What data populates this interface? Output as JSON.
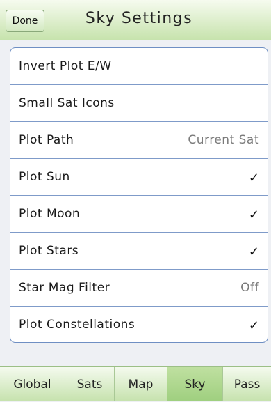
{
  "header": {
    "done_label": "Done",
    "title": "Sky Settings"
  },
  "settings": [
    {
      "label": "Invert Plot E/W",
      "value": "",
      "checked": false
    },
    {
      "label": "Small Sat Icons",
      "value": "",
      "checked": false
    },
    {
      "label": "Plot Path",
      "value": "Current Sat",
      "checked": false
    },
    {
      "label": "Plot Sun",
      "value": "",
      "checked": true
    },
    {
      "label": "Plot Moon",
      "value": "",
      "checked": true
    },
    {
      "label": "Plot Stars",
      "value": "",
      "checked": true
    },
    {
      "label": "Star Mag Filter",
      "value": "Off",
      "checked": false
    },
    {
      "label": "Plot Constellations",
      "value": "",
      "checked": true
    }
  ],
  "check_glyph": "✓",
  "tabs": [
    {
      "label": "Global",
      "active": false
    },
    {
      "label": "Sats",
      "active": false
    },
    {
      "label": "Map",
      "active": false
    },
    {
      "label": "Sky",
      "active": true
    },
    {
      "label": "Pass",
      "active": false
    }
  ],
  "colors": {
    "header_green": "#c7e3ad",
    "active_tab": "#9fcf7f",
    "row_border": "#7f9bc9"
  }
}
